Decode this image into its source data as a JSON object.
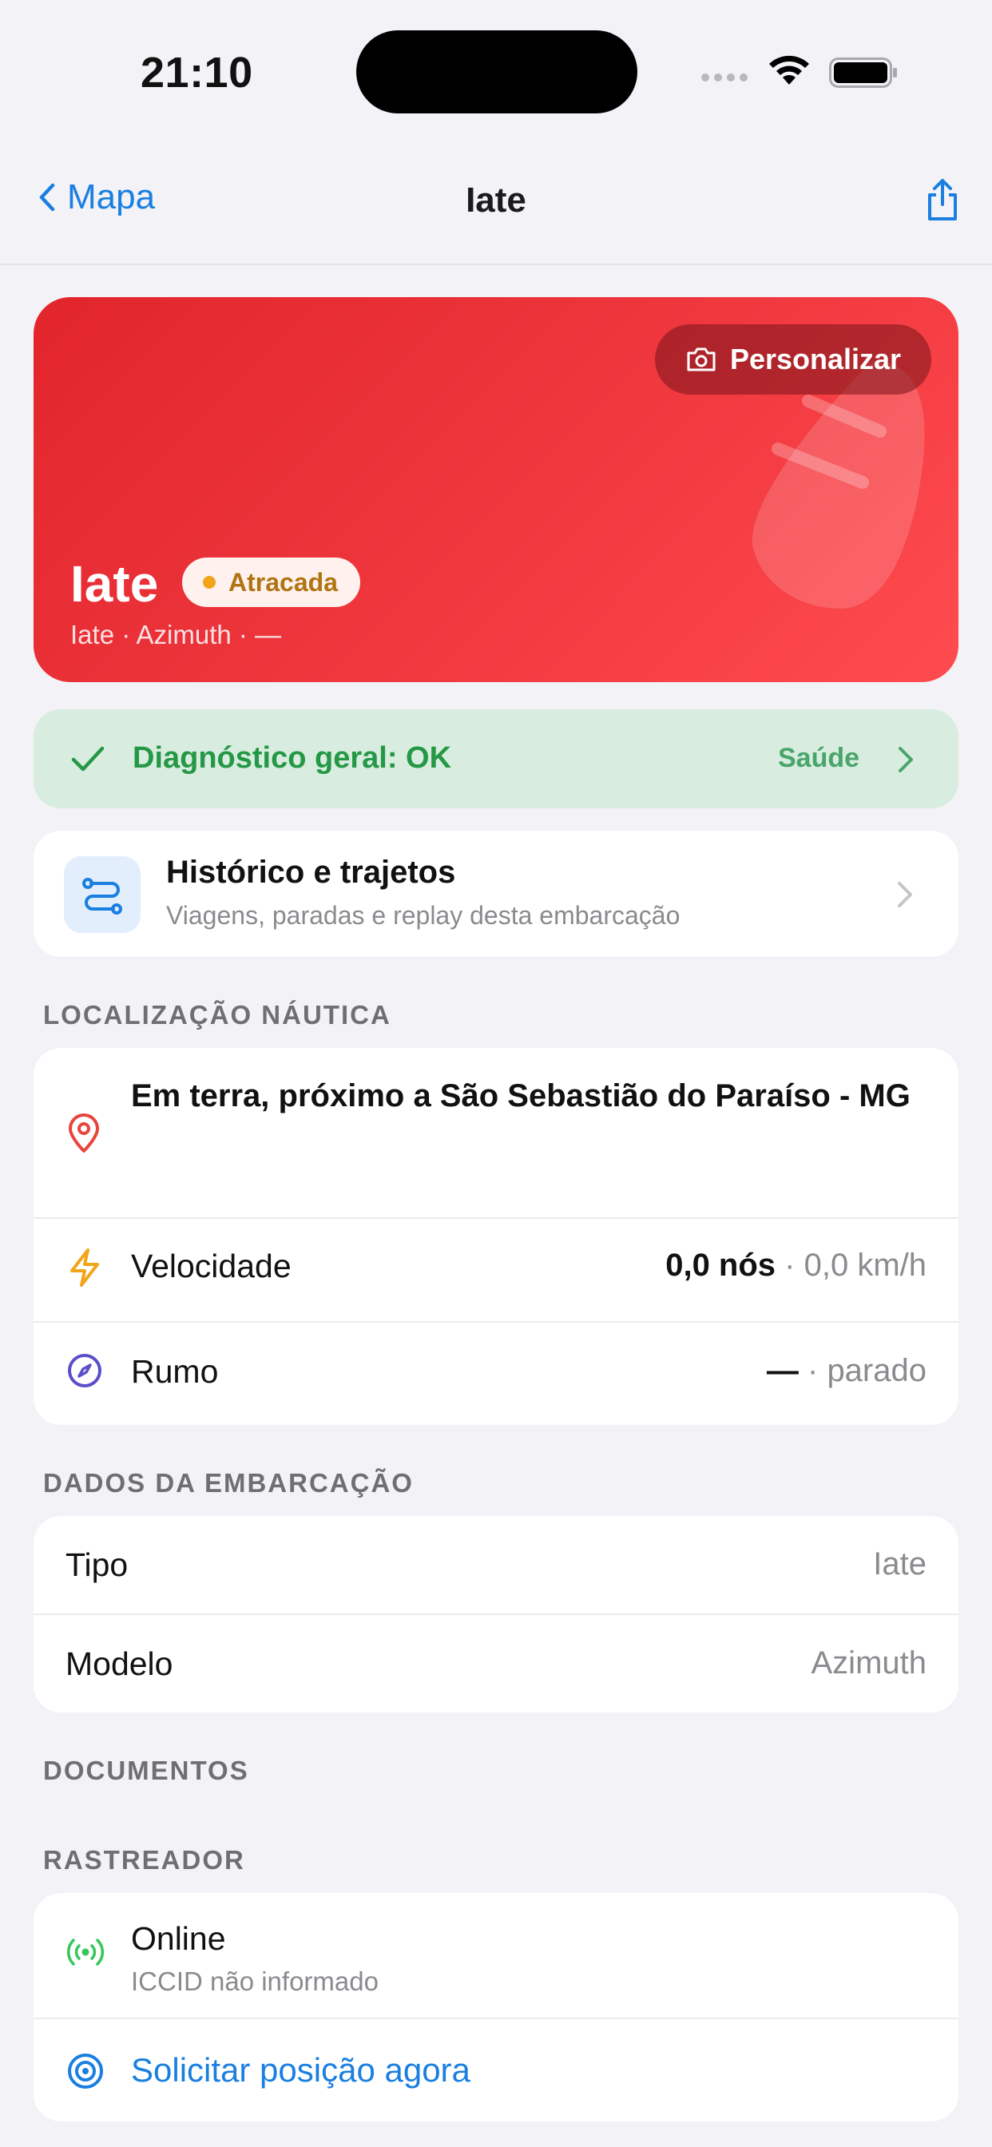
{
  "status_bar": {
    "time": "21:10"
  },
  "nav": {
    "back_label": "Mapa",
    "title": "Iate"
  },
  "hero": {
    "personalize_label": "Personalizar",
    "vessel_name": "Iate",
    "status_badge": "Atracada",
    "subtitle": "Iate · Azimuth · —",
    "colors": {
      "gradient_start": "#E2252C",
      "gradient_end": "#FF4B4F"
    }
  },
  "diagnostic": {
    "text": "Diagnóstico geral: OK",
    "link_label": "Saúde",
    "color": "#259845"
  },
  "history": {
    "title": "Histórico e trajetos",
    "subtitle": "Viagens, paradas e replay desta embarcação"
  },
  "location_section": {
    "header": "LOCALIZAÇÃO NÁUTICA",
    "location_text": "Em terra, próximo a São Sebastião do Paraíso - MG",
    "speed": {
      "label": "Velocidade",
      "value_primary": "0,0 nós",
      "value_secondary": " · 0,0 km/h"
    },
    "heading": {
      "label": "Rumo",
      "value_primary": "—",
      "value_secondary": " · parado"
    }
  },
  "vessel_section": {
    "header": "DADOS DA EMBARCAÇÃO",
    "rows": [
      {
        "label": "Tipo",
        "value": "Iate"
      },
      {
        "label": "Modelo",
        "value": "Azimuth"
      }
    ]
  },
  "documents_section": {
    "header": "DOCUMENTOS"
  },
  "tracker_section": {
    "header": "RASTREADOR",
    "status_label": "Online",
    "status_sub": "ICCID não informado",
    "request_label": "Solicitar posição agora"
  },
  "icons": {
    "back": "chevron-left-icon",
    "share": "share-icon",
    "camera": "camera-icon",
    "check": "checkmark-icon",
    "history": "route-icon",
    "pin": "location-pin-icon",
    "speed": "bolt-icon",
    "heading": "compass-icon",
    "online": "broadcast-icon",
    "request": "target-icon"
  },
  "accent_color": "#1A7FE0"
}
